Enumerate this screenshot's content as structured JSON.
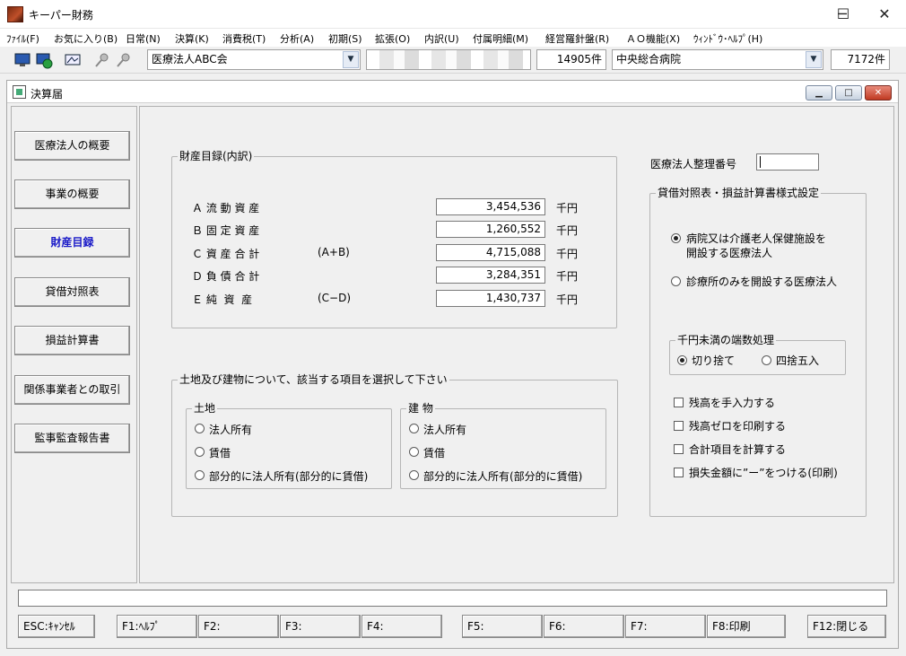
{
  "app": {
    "title": "キーパー財務"
  },
  "window_controls": {
    "minimize": "─",
    "maximize": "☐",
    "close": "✕"
  },
  "menu": [
    "ﾌｧｲﾙ(F)",
    "お気に入り(B)",
    "日常(N)",
    "決算(K)",
    "消費税(T)",
    "分析(A)",
    "初期(S)",
    "拡張(O)",
    "内訳(U)",
    "付属明細(M)",
    "経営羅針盤(R)",
    "ＡＯ機能(X)",
    "ｳｨﾝﾄﾞｳ･ﾍﾙﾌﾟ(H)"
  ],
  "toolbar": {
    "company": "医療法人ABC会",
    "company_count": "14905件",
    "facility": "中央総合病院",
    "facility_count": "7172件"
  },
  "mdi": {
    "title": "決算届",
    "btn_min": "▁",
    "btn_max": "□",
    "btn_close": "✕"
  },
  "sidebar": {
    "items": [
      "医療法人の概要",
      "事業の概要",
      "財産目録",
      "貸借対照表",
      "損益計算書",
      "関係事業者との取引",
      "監事監査報告書"
    ]
  },
  "property": {
    "label": "財産目録(内訳)",
    "rows": [
      {
        "label": "Ａ 流 動 資 産",
        "note": "",
        "value": "3,454,536",
        "unit": "千円"
      },
      {
        "label": "Ｂ 固 定 資 産",
        "note": "",
        "value": "1,260,552",
        "unit": "千円"
      },
      {
        "label": "Ｃ 資 産 合 計",
        "note": "(A+B)",
        "value": "4,715,088",
        "unit": "千円"
      },
      {
        "label": "Ｄ 負 債 合 計",
        "note": "",
        "value": "3,284,351",
        "unit": "千円"
      },
      {
        "label": "Ｅ 純  資  産",
        "note": "(C−D)",
        "value": "1,430,737",
        "unit": "千円"
      }
    ]
  },
  "land_building": {
    "label": "土地及び建物について、該当する項目を選択して下さい",
    "land": {
      "label": "土地",
      "options": [
        "法人所有",
        "賃借",
        "部分的に法人所有(部分的に賃借)"
      ]
    },
    "building": {
      "label": "建 物",
      "options": [
        "法人所有",
        "賃借",
        "部分的に法人所有(部分的に賃借)"
      ]
    }
  },
  "registration": {
    "label": "医療法人整理番号",
    "value": ""
  },
  "format": {
    "label": "貸借対照表・損益計算書様式設定",
    "opt1_line1": "病院又は介護老人保健施設を",
    "opt1_line2": "開設する医療法人",
    "opt2": "診療所のみを開設する医療法人",
    "rounding_label": "千円未満の端数処理",
    "round_down": "切り捨て",
    "round_half": "四捨五入",
    "checks": [
      "残高を手入力する",
      "残高ゼロを印刷する",
      "合計項目を計算する",
      "損失金額に”ー”をつける(印刷)"
    ]
  },
  "fkeys": [
    "ESC:ｷｬﾝｾﾙ",
    "F1:ﾍﾙﾌﾟ",
    "F2:",
    "F3:",
    "F4:",
    "F5:",
    "F6:",
    "F7:",
    "F8:印刷",
    "F12:閉じる"
  ]
}
